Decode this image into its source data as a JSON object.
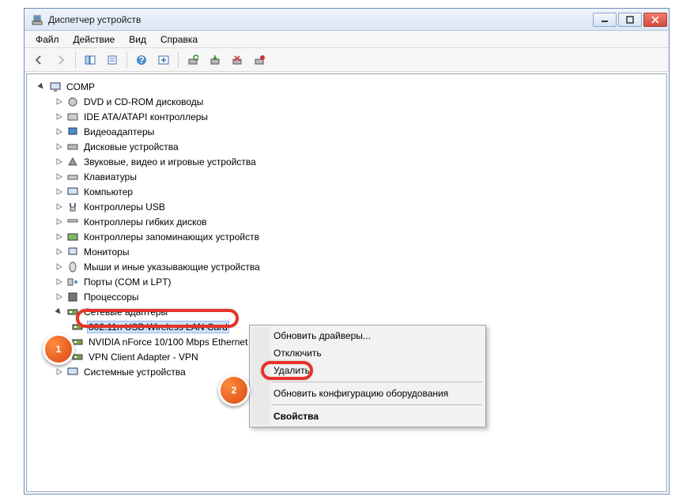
{
  "window": {
    "title": "Диспетчер устройств"
  },
  "menu": {
    "file": "Файл",
    "action": "Действие",
    "view": "Вид",
    "help": "Справка"
  },
  "root": {
    "name": "COMP"
  },
  "cats": [
    {
      "label": "DVD и CD-ROM дисководы"
    },
    {
      "label": "IDE ATA/ATAPI контроллеры"
    },
    {
      "label": "Видеоадаптеры"
    },
    {
      "label": "Дисковые устройства"
    },
    {
      "label": "Звуковые, видео и игровые устройства"
    },
    {
      "label": "Клавиатуры"
    },
    {
      "label": "Компьютер"
    },
    {
      "label": "Контроллеры USB"
    },
    {
      "label": "Контроллеры гибких дисков"
    },
    {
      "label": "Контроллеры запоминающих устройств"
    },
    {
      "label": "Мониторы"
    },
    {
      "label": "Мыши и иные указывающие устройства"
    },
    {
      "label": "Порты (COM и LPT)"
    },
    {
      "label": "Процессоры"
    }
  ],
  "netcat": {
    "label": "Сетевые адаптеры"
  },
  "adapters": [
    {
      "label": "802.11n USB Wireless LAN Card"
    },
    {
      "label": "NVIDIA nForce 10/100 Mbps Ethernet"
    },
    {
      "label": "VPN Client Adapter - VPN"
    }
  ],
  "syscat": {
    "label": "Системные устройства"
  },
  "ctx": {
    "update": "Обновить драйверы...",
    "disable": "Отключить",
    "delete": "Удалить",
    "rescan": "Обновить конфигурацию оборудования",
    "props": "Свойства"
  },
  "badges": {
    "one": "1",
    "two": "2"
  }
}
